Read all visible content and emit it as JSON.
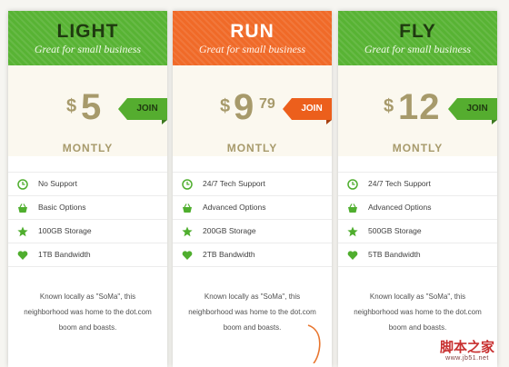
{
  "plans": [
    {
      "name": "LIGHT",
      "tagline": "Great for small business",
      "currency": "$",
      "amount": "5",
      "cents": "",
      "period": "MONTLY",
      "join_label": "JOIN",
      "features": [
        "No Support",
        "Basic Options",
        "100GB Storage",
        "1TB Bandwidth"
      ],
      "description": "Known locally as \"SoMa\", this neighborhood was home to the dot.com boom and boasts."
    },
    {
      "name": "RUN",
      "tagline": "Great for small business",
      "currency": "$",
      "amount": "9",
      "cents": "79",
      "period": "MONTLY",
      "join_label": "JOIN",
      "features": [
        "24/7 Tech Support",
        "Advanced Options",
        "200GB Storage",
        "2TB Bandwidth"
      ],
      "description": "Known locally as \"SoMa\", this neighborhood was home to the dot.com boom and boasts."
    },
    {
      "name": "FLY",
      "tagline": "Great for small business",
      "currency": "$",
      "amount": "12",
      "cents": "",
      "period": "MONTLY",
      "join_label": "JOIN",
      "features": [
        "24/7 Tech Support",
        "Advanced Options",
        "500GB Storage",
        "5TB Bandwidth"
      ],
      "description": "Known locally as \"SoMa\", this neighborhood was home to the dot.com boom and boasts."
    }
  ],
  "feature_icons": [
    "clock-icon",
    "basket-icon",
    "star-icon",
    "heart-icon"
  ],
  "colors": {
    "green": "#58b334",
    "orange": "#f06a28",
    "price_text": "#a79a6b",
    "icon_green": "#4fae2e"
  },
  "watermark": {
    "main": "脚本之家",
    "sub": "www.jb51.net"
  }
}
